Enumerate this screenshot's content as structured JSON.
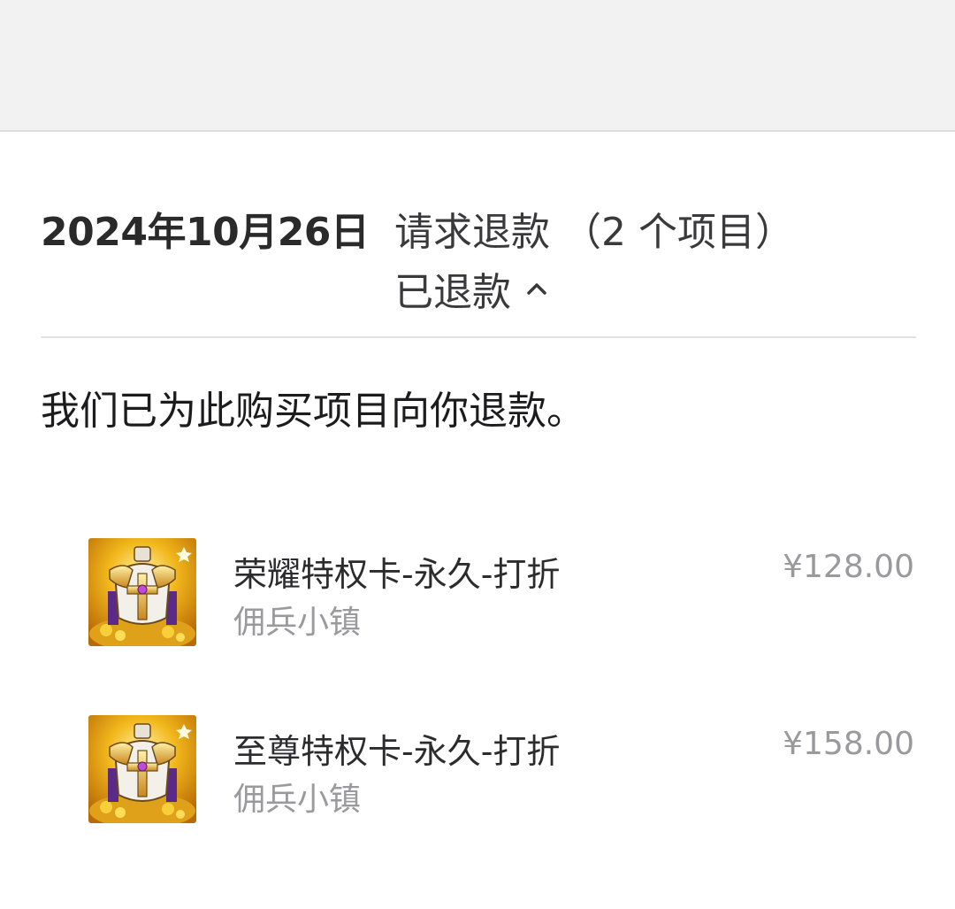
{
  "order": {
    "date": "2024年10月26日",
    "action": "请求退款 （2 个项目）",
    "status": "已退款",
    "status_icon": "chevron-up-icon"
  },
  "refund_message": "我们已为此购买项目向你退款。",
  "items": [
    {
      "name": "荣耀特权卡-永久-打折",
      "app": "佣兵小镇",
      "price": "¥128.00",
      "icon": "game-armor-icon"
    },
    {
      "name": "至尊特权卡-永久-打折",
      "app": "佣兵小镇",
      "price": "¥158.00",
      "icon": "game-armor-icon"
    }
  ],
  "colors": {
    "top_bar": "#f2f2f2",
    "secondary_text": "#9a9a9e",
    "divider": "#e2e2e2"
  }
}
